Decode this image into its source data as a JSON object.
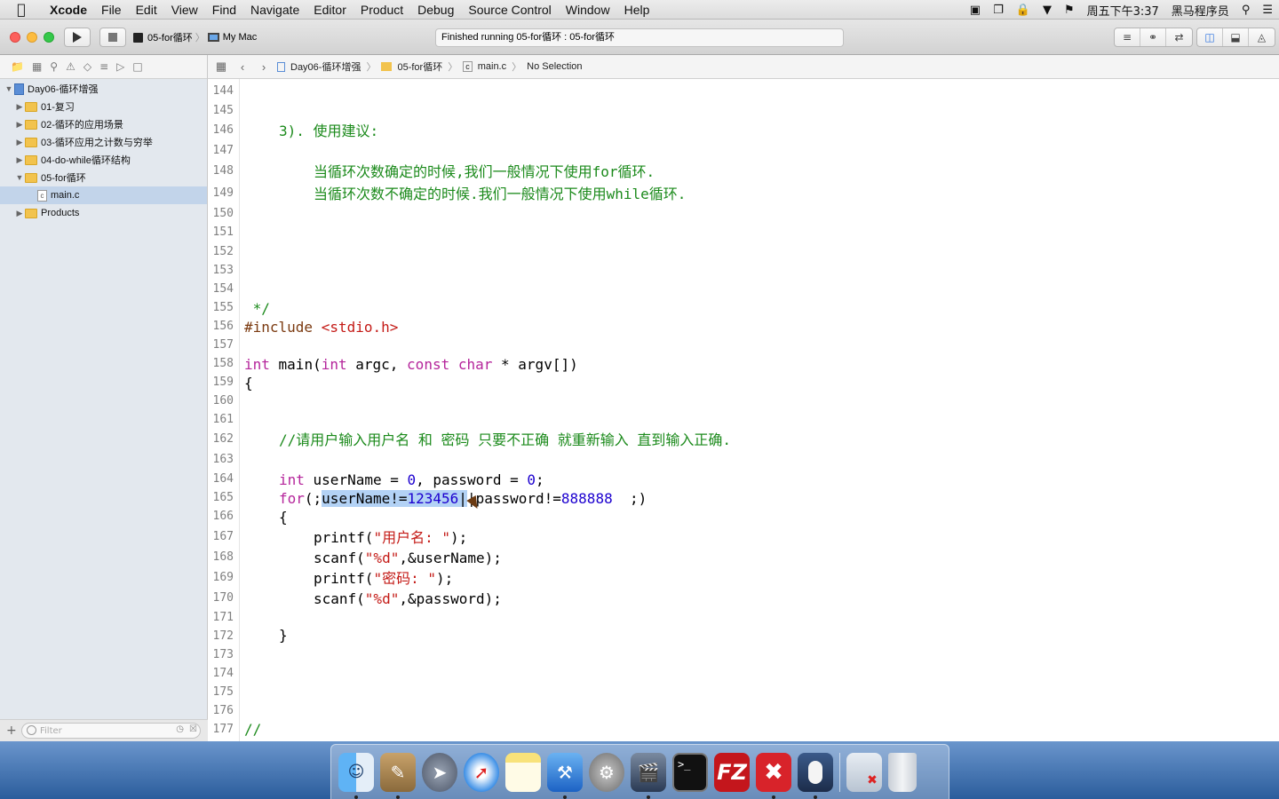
{
  "menubar": {
    "app": "Xcode",
    "items": [
      "File",
      "Edit",
      "View",
      "Find",
      "Navigate",
      "Editor",
      "Product",
      "Debug",
      "Source Control",
      "Window",
      "Help"
    ],
    "clock": "周五下午3:37",
    "user": "黑马程序员"
  },
  "toolbar": {
    "scheme": "05-for循环",
    "destination": "My Mac",
    "activity": "Finished running 05-for循环 : 05-for循环"
  },
  "jumpbar": {
    "project": "Day06-循环增强",
    "group": "05-for循环",
    "file": "main.c",
    "symbol": "No Selection"
  },
  "navigator": {
    "project": "Day06-循环增强",
    "groups": [
      {
        "label": "01-复习"
      },
      {
        "label": "02-循环的应用场景"
      },
      {
        "label": "03-循环应用之计数与穷举"
      },
      {
        "label": "04-do-while循环结构"
      },
      {
        "label": "05-for循环"
      }
    ],
    "file": "main.c",
    "products": "Products",
    "filter_placeholder": "Filter"
  },
  "editor": {
    "line_numbers": [
      "144",
      "145",
      "146",
      "147",
      "148",
      "149",
      "150",
      "151",
      "152",
      "153",
      "154",
      "155",
      "156",
      "157",
      "158",
      "159",
      "160",
      "161",
      "162",
      "163",
      "164",
      "165",
      "166",
      "167",
      "168",
      "169",
      "170",
      "171",
      "172",
      "173",
      "174",
      "175",
      "176",
      "177"
    ],
    "l146": "3). 使用建议:",
    "l148": "当循环次数确定的时候,我们一般情况下使用for循环.",
    "l149": "当循环次数不确定的时候.我们一般情况下使用while循环.",
    "l155": " */",
    "l156_a": "#include ",
    "l156_b": "<stdio.h>",
    "l158_kw1": "int",
    "l158_a": " main(",
    "l158_kw2": "int",
    "l158_b": " argc, ",
    "l158_kw3": "const",
    "l158_c": " ",
    "l158_kw4": "char",
    "l158_d": " * argv[])",
    "l159": "{",
    "l162": "//请用户输入用户名 和 密码 只要不正确 就重新输入 直到输入正确.",
    "l164_kw": "int",
    "l164_a": " userName = ",
    "l164_n1": "0",
    "l164_b": ", password = ",
    "l164_n2": "0",
    "l164_c": ";",
    "l165_kw": "for",
    "l165_a": "(;",
    "l165_sel_a": "userName!=",
    "l165_sel_n": "123456",
    "l165_sel_b": "|",
    "l165_b": "|password!=",
    "l165_n": "888888",
    "l165_c": "  ;)",
    "l166": "{",
    "l167_a": "printf(",
    "l167_s": "\"用户名: \"",
    "l167_b": ");",
    "l168_a": "scanf(",
    "l168_s": "\"%d\"",
    "l168_b": ",&userName);",
    "l169_a": "printf(",
    "l169_s": "\"密码: \"",
    "l169_b": ");",
    "l170_a": "scanf(",
    "l170_s": "\"%d\"",
    "l170_b": ",&password);",
    "l172": "}",
    "l177": "//"
  },
  "dock": {
    "apps": [
      "finder-icon",
      "preview-icon",
      "launchpad-icon",
      "safari-icon",
      "notes-icon",
      "xcode-icon",
      "system-preferences-icon",
      "movie-icon",
      "terminal-icon",
      "filezilla-icon",
      "xmind-icon",
      "mouse-icon"
    ],
    "terminal_label": ">_",
    "filezilla_label": "FZ"
  }
}
